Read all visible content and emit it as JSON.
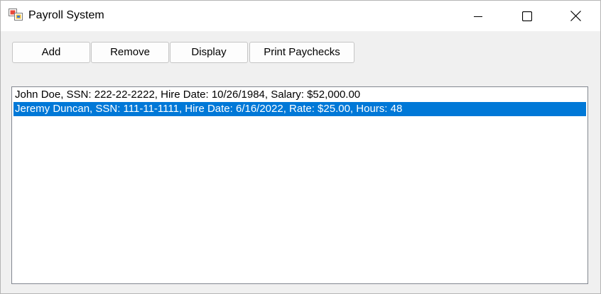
{
  "window": {
    "title": "Payroll System",
    "icon": "winforms-app-icon"
  },
  "caption_buttons": {
    "minimize": "minimize-icon",
    "maximize": "maximize-icon",
    "close": "close-icon"
  },
  "toolbar": {
    "add_label": "Add",
    "remove_label": "Remove",
    "display_label": "Display",
    "print_label": "Print Paychecks"
  },
  "employee_list": {
    "items": [
      {
        "text": "John  Doe, SSN: 222-22-2222, Hire Date: 10/26/1984, Salary: $52,000.00",
        "selected": false
      },
      {
        "text": "Jeremy Duncan, SSN: 111-11-1111, Hire Date: 6/16/2022, Rate: $25.00, Hours: 48",
        "selected": true
      }
    ]
  },
  "colors": {
    "selection": "#0078d7",
    "window_background": "#f0f0f0",
    "titlebar": "#ffffff"
  }
}
